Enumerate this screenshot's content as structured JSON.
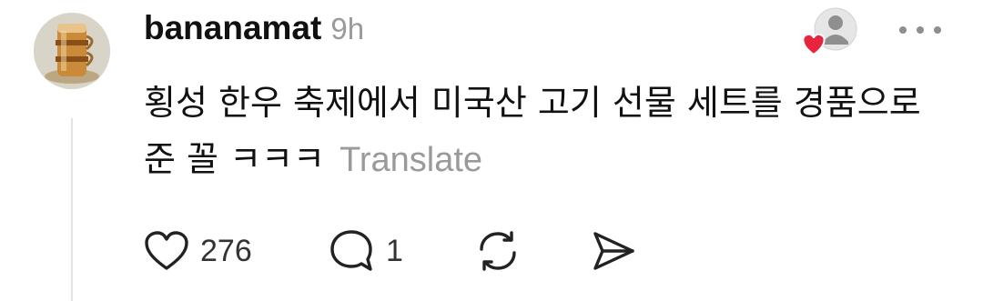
{
  "post": {
    "username": "bananamat",
    "time": "9h",
    "text": "횡성 한우 축제에서 미국산 고기 선물 세트를 경품으로 준 꼴 ㅋㅋㅋ",
    "translate_label": "Translate"
  },
  "actions": {
    "like_count": "276",
    "reply_count": "1"
  },
  "icons": {
    "avatar": "tea-glass-avatar-image",
    "follow": "follow-heart-person-icon",
    "more": "more-options-icon",
    "like": "heart-icon",
    "reply": "comment-bubble-icon",
    "repost": "repost-icon",
    "share": "send-icon"
  },
  "colors": {
    "heart_red": "#e8253f",
    "muted_gray": "#9a9a9a"
  }
}
